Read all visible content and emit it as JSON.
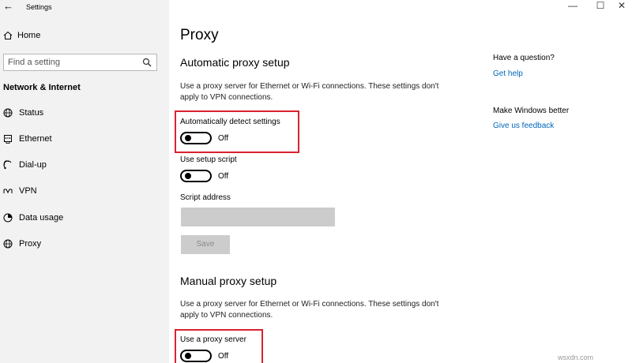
{
  "window": {
    "title": "Settings",
    "back_glyph": "←",
    "minimize_glyph": "—",
    "maximize_glyph": "☐",
    "close_glyph": "✕"
  },
  "sidebar": {
    "home_label": "Home",
    "search_placeholder": "Find a setting",
    "section_title": "Network & Internet",
    "items": [
      {
        "label": "Status",
        "icon": "globe-icon"
      },
      {
        "label": "Ethernet",
        "icon": "ethernet-icon"
      },
      {
        "label": "Dial-up",
        "icon": "dialup-icon"
      },
      {
        "label": "VPN",
        "icon": "vpn-icon"
      },
      {
        "label": "Data usage",
        "icon": "data-usage-icon"
      },
      {
        "label": "Proxy",
        "icon": "proxy-globe-icon"
      }
    ]
  },
  "main": {
    "title": "Proxy",
    "automatic": {
      "heading": "Automatic proxy setup",
      "description": "Use a proxy server for Ethernet or Wi-Fi connections. These settings don't apply to VPN connections.",
      "detect_label": "Automatically detect settings",
      "detect_state": "Off",
      "script_label": "Use setup script",
      "script_state": "Off",
      "address_label": "Script address",
      "address_value": "",
      "save_label": "Save"
    },
    "manual": {
      "heading": "Manual proxy setup",
      "description": "Use a proxy server for Ethernet or Wi-Fi connections. These settings don't apply to VPN connections.",
      "proxy_label": "Use a proxy server",
      "proxy_state": "Off"
    }
  },
  "right": {
    "question_heading": "Have a question?",
    "help_link": "Get help",
    "better_heading": "Make Windows better",
    "feedback_link": "Give us feedback"
  },
  "watermark": "wsxdn.com",
  "colors": {
    "highlight": "#d9232e",
    "link": "#0067b8",
    "sidebar_bg": "#f2f2f2"
  }
}
